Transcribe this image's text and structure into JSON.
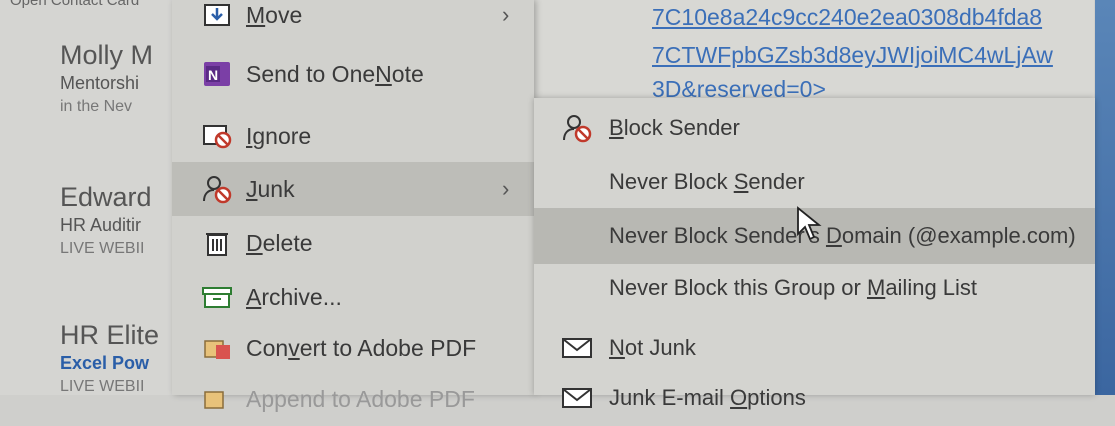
{
  "caption": "Open Contact Card",
  "mail_list": [
    {
      "name": "Molly M",
      "line1": "Mentorshi",
      "line2": "in the Nev"
    },
    {
      "name": "Edward",
      "line1": "HR Auditir",
      "line2": "LIVE WEBII"
    },
    {
      "name": "HR Elite",
      "line1": "Excel Pow",
      "line2": "LIVE WEBII"
    }
  ],
  "context_menu": {
    "items": [
      {
        "pre": "",
        "key": "M",
        "post": "ove",
        "icon": "move-icon",
        "has_submenu": true
      },
      {
        "pre": "Send to One",
        "key": "N",
        "post": "ote",
        "icon": "onenote-icon",
        "has_submenu": false
      },
      {
        "pre": "",
        "key": "I",
        "post": "gnore",
        "icon": "ignore-icon",
        "has_submenu": false
      },
      {
        "pre": "",
        "key": "J",
        "post": "unk",
        "icon": "junk-icon",
        "has_submenu": true
      },
      {
        "pre": "",
        "key": "D",
        "post": "elete",
        "icon": "delete-icon",
        "has_submenu": false
      },
      {
        "pre": "",
        "key": "A",
        "post": "rchive...",
        "icon": "archive-icon",
        "has_submenu": false
      },
      {
        "pre": "Con",
        "key": "v",
        "post": "ert to Adobe PDF",
        "icon": "adobe-pdf-icon",
        "has_submenu": false
      },
      {
        "pre": "A",
        "key": "",
        "post": "ppend to Adobe PDF",
        "icon": "adobe-pdf-append-icon",
        "has_submenu": false
      }
    ],
    "arrow": "›"
  },
  "link_lines": [
    "7C10e8a24c9cc240e2ea0308db4fda8",
    "7CTWFpbGZsb3d8eyJWIjoiMC4wLjAw",
    "3D&reserved=0>"
  ],
  "junk_submenu": {
    "items": [
      {
        "pre": "",
        "key": "B",
        "post": "lock Sender",
        "icon": "block-sender-icon"
      },
      {
        "pre": "Never Block ",
        "key": "S",
        "post": "ender",
        "icon": ""
      },
      {
        "pre": "Never Block Sender's ",
        "key": "D",
        "post": "omain (@example.com)",
        "icon": ""
      },
      {
        "pre": "Never Block this Group or ",
        "key": "M",
        "post": "ailing List",
        "icon": ""
      },
      {
        "pre": "",
        "key": "N",
        "post": "ot Junk",
        "icon": "mail-icon"
      },
      {
        "pre": "Junk E-mail ",
        "key": "O",
        "post": "ptions",
        "icon": "mail-options-icon"
      }
    ]
  },
  "colors": {
    "link": "#3b6fb8",
    "hover": "#b8b8b3",
    "onenote": "#7b3fa6"
  }
}
